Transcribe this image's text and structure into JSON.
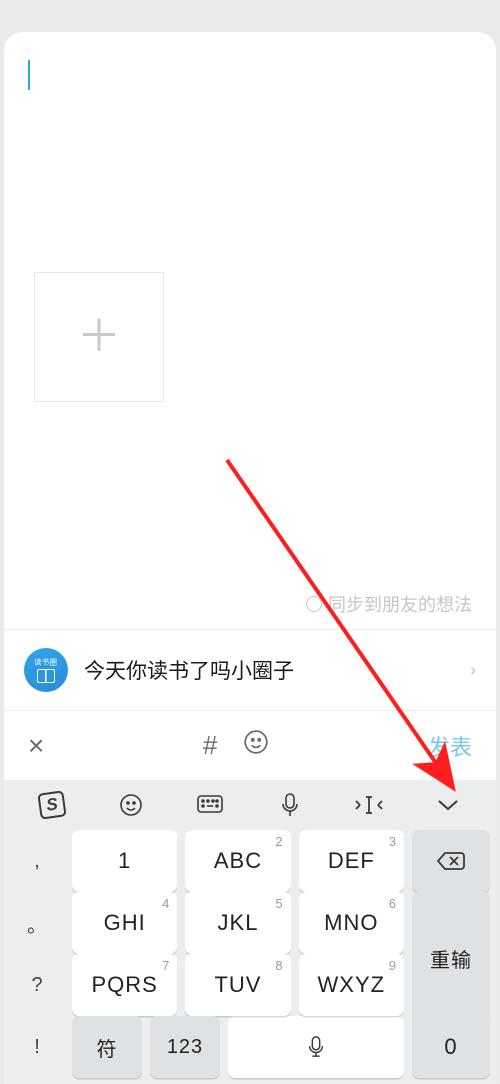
{
  "compose": {
    "placeholder": "",
    "value": ""
  },
  "sync": {
    "label": "同步到朋友的想法"
  },
  "group": {
    "avatar_badge": "读书圈",
    "name": "今天你读书了吗小圈子"
  },
  "actions": {
    "close": "×",
    "hash": "#",
    "publish": "发表"
  },
  "keyboard": {
    "toolbar": {
      "logo": "S"
    },
    "left_punct": [
      ",",
      "。",
      "?",
      "!"
    ],
    "keys": [
      {
        "n": "1",
        "l": ""
      },
      {
        "n": "2",
        "l": "ABC"
      },
      {
        "n": "3",
        "l": "DEF"
      },
      {
        "n": "4",
        "l": "GHI"
      },
      {
        "n": "5",
        "l": "JKL"
      },
      {
        "n": "6",
        "l": "MNO"
      },
      {
        "n": "7",
        "l": "PQRS"
      },
      {
        "n": "8",
        "l": "TUV"
      },
      {
        "n": "9",
        "l": "WXYZ"
      }
    ],
    "right": {
      "backspace": "⌫",
      "reinput": "重输",
      "zero": "0"
    },
    "bottom": {
      "symbols": "符",
      "numeric": "123"
    }
  }
}
